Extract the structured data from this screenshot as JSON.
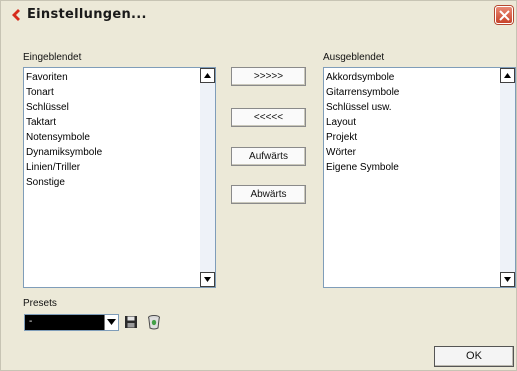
{
  "window": {
    "title": "Einstellungen..."
  },
  "left_list": {
    "label": "Eingeblendet",
    "items": [
      "Favoriten",
      "Tonart",
      "Schlüssel",
      "Taktart",
      "Notensymbole",
      "Dynamiksymbole",
      "Linien/Triller",
      "Sonstige"
    ]
  },
  "right_list": {
    "label": "Ausgeblendet",
    "items": [
      "Akkordsymbole",
      "Gitarrensymbole",
      "Schlüssel usw.",
      "Layout",
      "Projekt",
      "Wörter",
      "Eigene Symbole"
    ]
  },
  "buttons": {
    "show_all": ">>>>>",
    "hide_all": "<<<<<",
    "up": "Aufwärts",
    "down": "Abwärts",
    "ok": "OK"
  },
  "presets": {
    "label": "Presets",
    "value": "-"
  },
  "icons": {
    "title": "cubase-logo-icon",
    "save": "save-icon",
    "delete": "trash-icon",
    "close": "close-icon"
  },
  "colors": {
    "accent_red": "#d62b1c",
    "close_button": "#c8432a",
    "list_border": "#7f9db9"
  }
}
